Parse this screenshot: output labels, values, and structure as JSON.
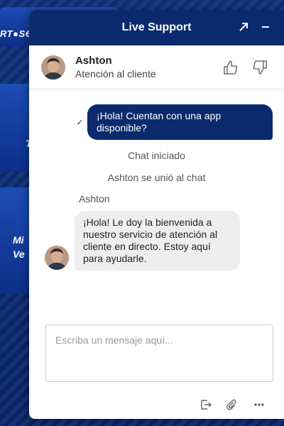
{
  "background": {
    "card1_text": "RT●S€",
    "card2_text": "T",
    "card3_line1": "Mi",
    "card3_line2": "Ve"
  },
  "widget": {
    "title": "Live Support",
    "accent_color": "#0b2a6e"
  },
  "agent": {
    "name": "Ashton",
    "role": "Atención al cliente"
  },
  "messages": {
    "outgoing_text": "¡Hola! Cuentan con una app disponible?",
    "system_1": "Chat iniciado",
    "system_2": "Ashton se unió al chat",
    "incoming_sender": "Ashton",
    "incoming_text": "¡Hola! Le doy la bienvenida a nuestro servicio de atención al cliente en directo. Estoy aquí para ayudarle."
  },
  "composer": {
    "placeholder": "Escriba un mensaje aquí..."
  },
  "icons": {
    "popout": "popout-arrow-icon",
    "minimize": "minimize-icon",
    "thumbs_up": "thumbs-up-icon",
    "thumbs_down": "thumbs-down-icon",
    "end_chat": "end-chat-icon",
    "attach": "paperclip-icon",
    "more": "more-options-icon"
  }
}
